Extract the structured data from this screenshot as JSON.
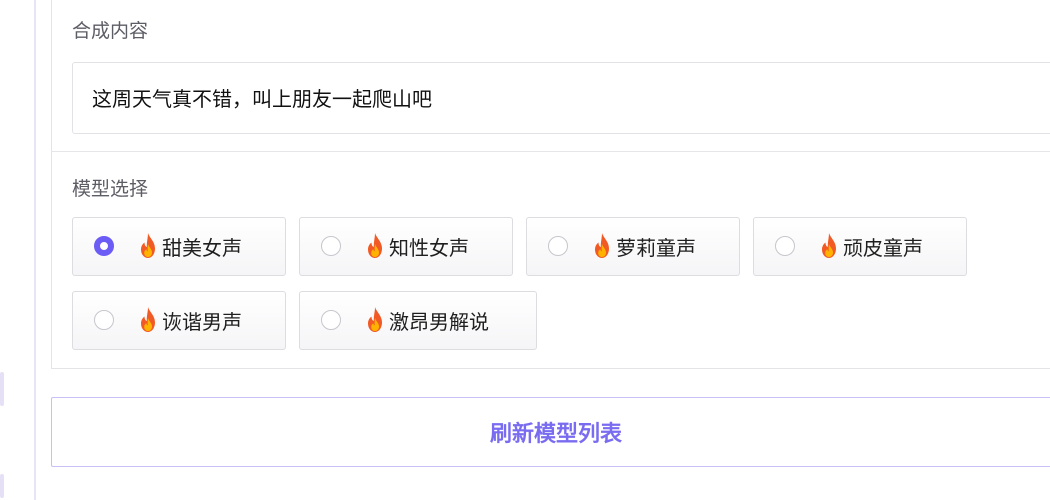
{
  "synthesis": {
    "label": "合成内容",
    "text": "这周天气真不错，叫上朋友一起爬山吧"
  },
  "model_select": {
    "label": "模型选择",
    "icon": "fire-icon",
    "selected_index": 0,
    "options": [
      {
        "label": "甜美女声",
        "checked": true
      },
      {
        "label": "知性女声",
        "checked": false
      },
      {
        "label": "萝莉童声",
        "checked": false
      },
      {
        "label": "顽皮童声",
        "checked": false
      },
      {
        "label": "诙谐男声",
        "checked": false
      },
      {
        "label": "激昂男解说",
        "checked": false
      }
    ]
  },
  "refresh_button": {
    "label": "刷新模型列表"
  },
  "colors": {
    "accent": "#6b5cf5",
    "button_text": "#7a6cf0",
    "button_border": "#c8bff7",
    "flame_outer": "#f15a24",
    "flame_inner": "#ffb300"
  }
}
